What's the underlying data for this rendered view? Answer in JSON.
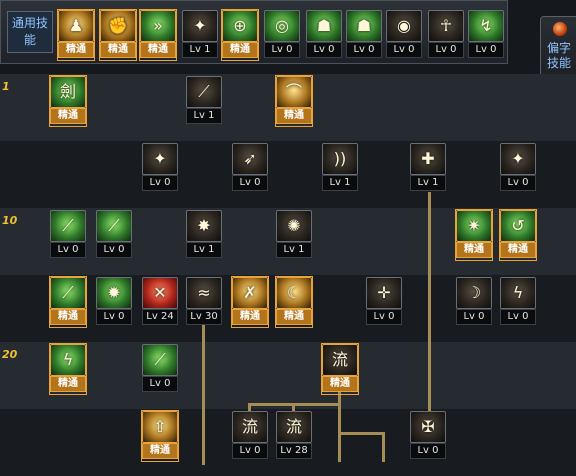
{
  "labels": {
    "common_skills": "通用技能",
    "special_skills": "偏字技能"
  },
  "row_markers": {
    "r1": "1",
    "r10": "10",
    "r20": "20"
  },
  "common_bar": [
    {
      "name": "common-skill-1",
      "icon": "runner-icon",
      "glyph": "♟",
      "style": "gold",
      "level": "精通",
      "mastered": true
    },
    {
      "name": "common-skill-2",
      "icon": "fist-icon",
      "glyph": "✊",
      "style": "gold",
      "level": "精通",
      "mastered": true
    },
    {
      "name": "common-skill-3",
      "icon": "dash-icon",
      "glyph": "»",
      "style": "green",
      "level": "精通",
      "mastered": true
    },
    {
      "name": "common-skill-4",
      "icon": "wings-icon",
      "glyph": "✦",
      "style": "dark",
      "level": "Lv 1",
      "mastered": false
    },
    {
      "name": "common-skill-5",
      "icon": "crosshair-icon",
      "glyph": "⊕",
      "style": "green",
      "level": "精通",
      "mastered": true
    },
    {
      "name": "common-skill-6",
      "icon": "target-icon",
      "glyph": "◎",
      "style": "green",
      "level": "Lv 0",
      "mastered": false
    },
    {
      "name": "common-skill-7",
      "icon": "figure-icon",
      "glyph": "☗",
      "style": "green",
      "level": "Lv 0",
      "mastered": false
    },
    {
      "name": "common-skill-8",
      "icon": "figure-alt-icon",
      "glyph": "☗",
      "style": "green",
      "level": "Lv 0",
      "mastered": false
    },
    {
      "name": "common-skill-9",
      "icon": "eye-icon",
      "glyph": "◉",
      "style": "dark",
      "level": "Lv 0",
      "mastered": false
    },
    {
      "name": "common-skill-10",
      "icon": "meditate-icon",
      "glyph": "☥",
      "style": "dark",
      "level": "Lv 0",
      "mastered": false
    },
    {
      "name": "common-skill-11",
      "icon": "kick-icon",
      "glyph": "↯",
      "style": "green",
      "level": "Lv 0",
      "mastered": false
    }
  ],
  "tree_skills": [
    {
      "name": "tree-skill-r1-a",
      "icon": "sword-grid-icon",
      "glyph": "劍",
      "style": "green",
      "level": "精通",
      "mastered": true
    },
    {
      "name": "tree-skill-r1-b",
      "icon": "slash-icon",
      "glyph": "⟋",
      "style": "dark",
      "level": "Lv 1",
      "mastered": false
    },
    {
      "name": "tree-skill-r1-c",
      "icon": "arc-slash-icon",
      "glyph": "⌒",
      "style": "gold",
      "level": "精通",
      "mastered": true
    },
    {
      "name": "tree-skill-r2-a",
      "icon": "wings-icon",
      "glyph": "✦",
      "style": "dark",
      "level": "Lv 0",
      "mastered": false
    },
    {
      "name": "tree-skill-r2-b",
      "icon": "arrow-icon",
      "glyph": "➶",
      "style": "dark",
      "level": "Lv 0",
      "mastered": false
    },
    {
      "name": "tree-skill-r2-c",
      "icon": "shockwave-icon",
      "glyph": "))",
      "style": "dark",
      "level": "Lv 1",
      "mastered": false
    },
    {
      "name": "tree-skill-r2-d",
      "icon": "shield-icon",
      "glyph": "✚",
      "style": "dark",
      "level": "Lv 1",
      "mastered": false
    },
    {
      "name": "tree-skill-r2-e",
      "icon": "triple-wings-icon",
      "glyph": "✦",
      "style": "dark",
      "level": "Lv 0",
      "mastered": false
    },
    {
      "name": "tree-skill-r3-a",
      "icon": "blade-icon",
      "glyph": "⟋",
      "style": "green",
      "level": "Lv 0",
      "mastered": false
    },
    {
      "name": "tree-skill-r3-b",
      "icon": "blade-alt-icon",
      "glyph": "⟋",
      "style": "green",
      "level": "Lv 0",
      "mastered": false
    },
    {
      "name": "tree-skill-r3-c",
      "icon": "flame-icon",
      "glyph": "✸",
      "style": "dark",
      "level": "Lv 1",
      "mastered": false
    },
    {
      "name": "tree-skill-r3-d",
      "icon": "spiral-icon",
      "glyph": "✺",
      "style": "dark",
      "level": "Lv 1",
      "mastered": false
    },
    {
      "name": "tree-skill-r3-e",
      "icon": "energy-blade-icon",
      "glyph": "✷",
      "style": "green",
      "level": "精通",
      "mastered": true
    },
    {
      "name": "tree-skill-r3-f",
      "icon": "swoosh-icon",
      "glyph": "↺",
      "style": "green",
      "level": "精通",
      "mastered": true
    },
    {
      "name": "tree-skill-r4-a",
      "icon": "greatsword-icon",
      "glyph": "⟋",
      "style": "green",
      "level": "精通",
      "mastered": true
    },
    {
      "name": "tree-skill-r4-b",
      "icon": "burst-icon",
      "glyph": "✹",
      "style": "green",
      "level": "Lv 0",
      "mastered": false
    },
    {
      "name": "tree-skill-r4-c",
      "icon": "blood-slash-icon",
      "glyph": "✕",
      "style": "red",
      "level": "Lv 24",
      "mastered": false
    },
    {
      "name": "tree-skill-r4-d",
      "icon": "whirl-icon",
      "glyph": "≈",
      "style": "dark",
      "level": "Lv 30",
      "mastered": false
    },
    {
      "name": "tree-skill-r4-e",
      "icon": "strike-icon",
      "glyph": "✗",
      "style": "gold",
      "level": "精通",
      "mastered": true
    },
    {
      "name": "tree-skill-r4-f",
      "icon": "draw-icon",
      "glyph": "☾",
      "style": "gold",
      "level": "精通",
      "mastered": true
    },
    {
      "name": "tree-skill-r4-g",
      "icon": "cross-star-icon",
      "glyph": "✛",
      "style": "dark",
      "level": "Lv 0",
      "mastered": false
    },
    {
      "name": "tree-skill-r4-h",
      "icon": "crescent-icon",
      "glyph": "☽",
      "style": "dark",
      "level": "Lv 0",
      "mastered": false
    },
    {
      "name": "tree-skill-r4-i",
      "icon": "lightning-icon",
      "glyph": "ϟ",
      "style": "dark",
      "level": "Lv 0",
      "mastered": false
    },
    {
      "name": "tree-skill-r5-a",
      "icon": "lightning-blade-icon",
      "glyph": "ϟ",
      "style": "green",
      "level": "精通",
      "mastered": true
    },
    {
      "name": "tree-skill-r5-b",
      "icon": "twin-blade-icon",
      "glyph": "⟋",
      "style": "green",
      "level": "Lv 0",
      "mastered": false
    },
    {
      "name": "tree-skill-r5-c",
      "icon": "flow-glyph-icon",
      "glyph": "流",
      "style": "dark",
      "level": "精通",
      "mastered": true
    },
    {
      "name": "tree-skill-r6-a",
      "icon": "rising-icon",
      "glyph": "⇧",
      "style": "gold",
      "level": "精通",
      "mastered": true
    },
    {
      "name": "tree-skill-r6-b",
      "icon": "flow-wing-icon",
      "glyph": "流",
      "style": "dark",
      "level": "Lv 0",
      "mastered": false
    },
    {
      "name": "tree-skill-r6-c",
      "icon": "flow-moon-icon",
      "glyph": "流",
      "style": "dark",
      "level": "Lv 28",
      "mastered": false
    },
    {
      "name": "tree-skill-r6-d",
      "icon": "sword-burst-icon",
      "glyph": "✠",
      "style": "dark",
      "level": "Lv 0",
      "mastered": false
    }
  ]
}
